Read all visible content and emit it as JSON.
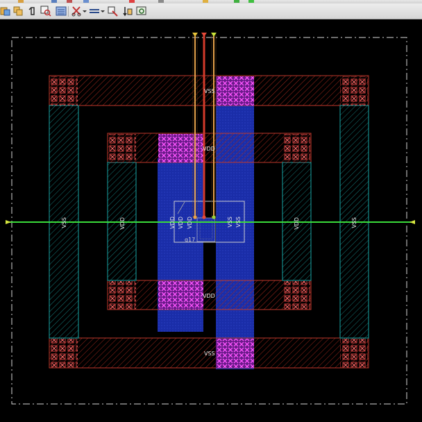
{
  "toolbar": {
    "buttons": [
      "layer-select",
      "layer-stack",
      "ruler",
      "zoom-to-fit",
      "layer-map",
      "cut",
      "dropdown",
      "align",
      "dropdown",
      "stretch",
      "rotate-move",
      "zoom-select"
    ]
  },
  "colors": {
    "background": "#000000",
    "metal_outline": "#c0392b",
    "diffusion_outline": "#17a3a3",
    "poly_blue": "#1c2fb0",
    "contact_magenta": "#e040e0",
    "guide_line": "#3adc3a",
    "boundary": "#d8d8d8"
  },
  "labels": {
    "vss_top": "VSS",
    "vss_bottom": "VSS",
    "vdd_top": "VDD",
    "vdd_bottom": "VDD",
    "vss_left": "VSS",
    "vdd_left": "VDD",
    "vdd_inner1": "VDD",
    "vdd_inner2": "VDD",
    "vdd_inner3": "VDD",
    "vss_inner1": "VSS",
    "vss_inner2": "VSS",
    "vdd_right": "VDD",
    "vss_right": "VSS",
    "instance": "g17"
  }
}
